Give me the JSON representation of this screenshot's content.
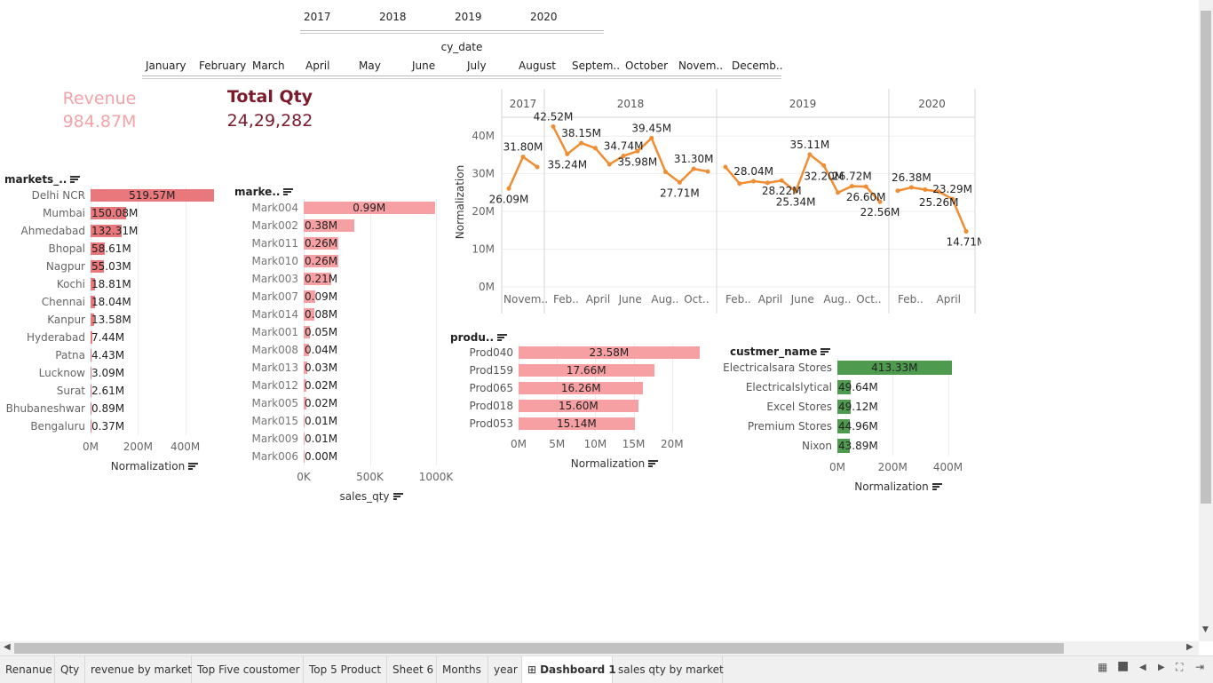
{
  "filters": {
    "years": [
      "2017",
      "2018",
      "2019",
      "2020"
    ],
    "month_title": "cy_date",
    "months": [
      "January",
      "February",
      "March",
      "April",
      "May",
      "June",
      "July",
      "August",
      "Septem..",
      "October",
      "Novem..",
      "Decemb.."
    ]
  },
  "kpis": {
    "revenue": {
      "title": "Revenue",
      "value": "984.87M",
      "color": "#f4a3a8"
    },
    "qty": {
      "title": "Total Qty",
      "value": "24,29,282",
      "color": "#7a1a2a"
    }
  },
  "chart_data": [
    {
      "type": "bar",
      "header": "markets_..",
      "categories": [
        "Delhi NCR",
        "Mumbai",
        "Ahmedabad",
        "Bhopal",
        "Nagpur",
        "Kochi",
        "Chennai",
        "Kanpur",
        "Hyderabad",
        "Patna",
        "Lucknow",
        "Surat",
        "Bhubaneshwar",
        "Bengaluru"
      ],
      "values": [
        519.57,
        150.08,
        132.31,
        58.61,
        55.03,
        18.81,
        18.04,
        13.58,
        7.44,
        4.43,
        3.09,
        2.61,
        0.89,
        0.37
      ],
      "labels": [
        "519.57M",
        "150.08M",
        "132.31M",
        "58.61M",
        "55.03M",
        "18.81M",
        "18.04M",
        "13.58M",
        "7.44M",
        "4.43M",
        "3.09M",
        "2.61M",
        "0.89M",
        "0.37M"
      ],
      "xticks": [
        "0M",
        "200M",
        "400M"
      ],
      "xlim": [
        0,
        540
      ],
      "xlabel": "Normalization",
      "color": "#e8787c"
    },
    {
      "type": "bar",
      "header": "marke..",
      "categories": [
        "Mark004",
        "Mark002",
        "Mark011",
        "Mark010",
        "Mark003",
        "Mark007",
        "Mark014",
        "Mark001",
        "Mark008",
        "Mark013",
        "Mark012",
        "Mark005",
        "Mark015",
        "Mark009",
        "Mark006"
      ],
      "values": [
        0.99,
        0.38,
        0.26,
        0.26,
        0.21,
        0.09,
        0.08,
        0.05,
        0.04,
        0.03,
        0.02,
        0.02,
        0.01,
        0.01,
        0.0
      ],
      "labels": [
        "0.99M",
        "0.38M",
        "0.26M",
        "0.26M",
        "0.21M",
        "0.09M",
        "0.08M",
        "0.05M",
        "0.04M",
        "0.03M",
        "0.02M",
        "0.02M",
        "0.01M",
        "0.01M",
        "0.00M"
      ],
      "xticks": [
        "0K",
        "500K",
        "1000K"
      ],
      "xlim": [
        0,
        1.02
      ],
      "xlabel": "sales_qty",
      "color": "#f7a0a4"
    },
    {
      "type": "line",
      "ylabel": "Normalization",
      "yticks": [
        "0M",
        "10M",
        "20M",
        "30M",
        "40M"
      ],
      "ylim": [
        0,
        45
      ],
      "color": "#f08c32",
      "panels": [
        {
          "year": "2017",
          "ticks": [
            "Novem.."
          ],
          "values": [
            26.09,
            34.5,
            31.8
          ],
          "labels": [
            {
              "i": 0,
              "text": "26.09M",
              "pos": "below"
            },
            {
              "i": 1,
              "text": "31.80M",
              "pos": "above"
            }
          ]
        },
        {
          "year": "2018",
          "ticks": [
            "Feb..",
            "April",
            "June",
            "Aug..",
            "Oct.."
          ],
          "values": [
            42.52,
            35.24,
            38.15,
            36.8,
            32.5,
            34.74,
            35.98,
            39.45,
            30.5,
            27.71,
            31.3,
            30.6
          ],
          "labels": [
            {
              "i": 0,
              "text": "42.52M",
              "pos": "above"
            },
            {
              "i": 1,
              "text": "35.24M",
              "pos": "below"
            },
            {
              "i": 2,
              "text": "38.15M",
              "pos": "above"
            },
            {
              "i": 5,
              "text": "34.74M",
              "pos": "above"
            },
            {
              "i": 6,
              "text": "35.98M",
              "pos": "below"
            },
            {
              "i": 7,
              "text": "39.45M",
              "pos": "above"
            },
            {
              "i": 9,
              "text": "27.71M",
              "pos": "below"
            },
            {
              "i": 10,
              "text": "31.30M",
              "pos": "above"
            }
          ]
        },
        {
          "year": "2019",
          "ticks": [
            "Feb..",
            "April",
            "June",
            "Aug..",
            "Oct.."
          ],
          "values": [
            31.8,
            27.4,
            28.04,
            27.6,
            28.22,
            25.34,
            35.11,
            32.2,
            25.0,
            26.72,
            26.6,
            22.56
          ],
          "labels": [
            {
              "i": 2,
              "text": "28.04M",
              "pos": "above"
            },
            {
              "i": 4,
              "text": "28.22M",
              "pos": "below"
            },
            {
              "i": 5,
              "text": "25.34M",
              "pos": "below"
            },
            {
              "i": 6,
              "text": "35.11M",
              "pos": "above"
            },
            {
              "i": 7,
              "text": "32.20M",
              "pos": "below"
            },
            {
              "i": 9,
              "text": "26.72M",
              "pos": "above"
            },
            {
              "i": 10,
              "text": "26.60M",
              "pos": "below"
            },
            {
              "i": 11,
              "text": "22.56M",
              "pos": "below"
            }
          ]
        },
        {
          "year": "2020",
          "ticks": [
            "Feb..",
            "April"
          ],
          "values": [
            25.5,
            26.38,
            25.8,
            25.26,
            23.29,
            14.71
          ],
          "labels": [
            {
              "i": 1,
              "text": "26.38M",
              "pos": "above"
            },
            {
              "i": 3,
              "text": "25.26M",
              "pos": "below"
            },
            {
              "i": 4,
              "text": "23.29M",
              "pos": "above"
            },
            {
              "i": 5,
              "text": "14.71M",
              "pos": "below"
            }
          ]
        }
      ]
    },
    {
      "type": "bar",
      "header": "produ..",
      "categories": [
        "Prod040",
        "Prod159",
        "Prod065",
        "Prod018",
        "Prod053"
      ],
      "values": [
        23.58,
        17.66,
        16.26,
        15.6,
        15.14
      ],
      "labels": [
        "23.58M",
        "17.66M",
        "16.26M",
        "15.60M",
        "15.14M"
      ],
      "xticks": [
        "0M",
        "5M",
        "10M",
        "15M",
        "20M"
      ],
      "xlim": [
        0,
        25
      ],
      "xlabel": "Normalization",
      "color": "#f7a0a4"
    },
    {
      "type": "bar",
      "header": "custmer_name",
      "categories": [
        "Electricalsara Stores",
        "Electricalslytical",
        "Excel Stores",
        "Premium Stores",
        "Nixon"
      ],
      "values": [
        413.33,
        49.64,
        49.12,
        44.96,
        43.89
      ],
      "labels": [
        "413.33M",
        "49.64M",
        "49.12M",
        "44.96M",
        "43.89M"
      ],
      "xticks": [
        "0M",
        "200M",
        "400M"
      ],
      "xlim": [
        0,
        440
      ],
      "xlabel": "Normalization",
      "color": "#4e9a4e"
    }
  ],
  "tabs": [
    "Renanue",
    "Qty",
    "revenue by market",
    "Top Five coustomer",
    "Top 5 Product",
    "Sheet 6",
    "Months",
    "year",
    "Dashboard 1",
    "sales qty by market"
  ],
  "active_tab": "Dashboard 1",
  "nav_icons": [
    "grid-view-icon",
    "filmstrip-view-icon",
    "first-sheet-icon",
    "previous-sheet-icon",
    "next-sheet-icon",
    "fit-screen-icon",
    "last-sheet-icon"
  ]
}
